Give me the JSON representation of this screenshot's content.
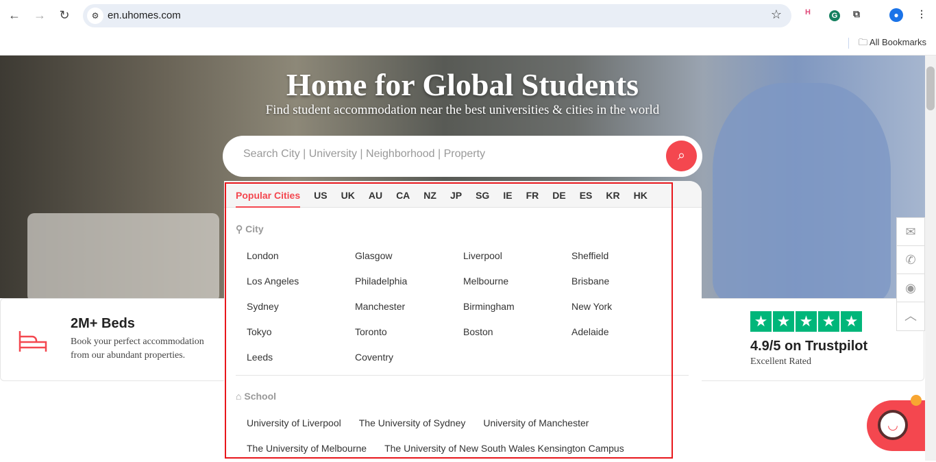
{
  "browser": {
    "url": "en.uhomes.com",
    "bookmarks_label": "All Bookmarks"
  },
  "hero": {
    "title": "Home for Global Students",
    "subtitle": "Find student accommodation near the best universities & cities in the world",
    "search_placeholder": "Search City | University | Neighborhood | Property"
  },
  "tabs": [
    "Popular Cities",
    "US",
    "UK",
    "AU",
    "CA",
    "NZ",
    "JP",
    "SG",
    "IE",
    "FR",
    "DE",
    "ES",
    "KR",
    "HK"
  ],
  "city_section": {
    "label": "City",
    "items": [
      "London",
      "Glasgow",
      "Liverpool",
      "Sheffield",
      "Los Angeles",
      "Philadelphia",
      "Melbourne",
      "Brisbane",
      "Sydney",
      "Manchester",
      "Birmingham",
      "New York",
      "Tokyo",
      "Toronto",
      "Boston",
      "Adelaide",
      "Leeds",
      "Coventry"
    ]
  },
  "school_section": {
    "label": "School",
    "items": [
      "University of Liverpool",
      "The University of Sydney",
      "University of Manchester",
      "The University of Melbourne",
      "The University of New South Wales Kensington Campus"
    ]
  },
  "stats": {
    "beds_title": "2M+ Beds",
    "beds_desc_1": "Book your perfect accommodation",
    "beds_desc_2": "from our abundant properties.",
    "rating_title": "4.9/5 on Trustpilot",
    "rating_desc": "Excellent Rated",
    "rating_stars": 5
  },
  "colors": {
    "accent": "#f4474f",
    "trustpilot": "#00b67a",
    "highlight": "#e8161b"
  }
}
